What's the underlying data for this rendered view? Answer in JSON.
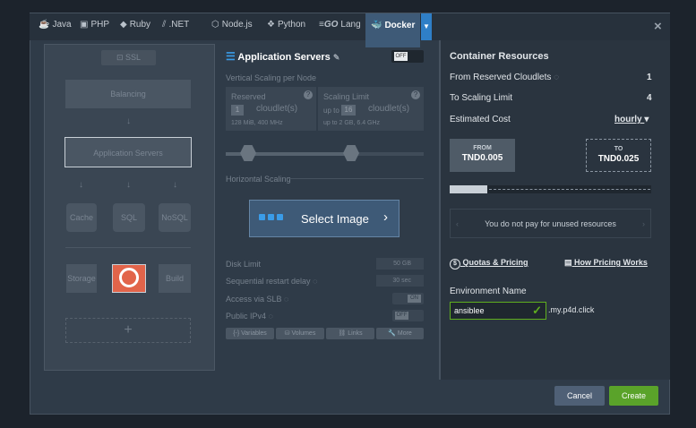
{
  "tabs": [
    {
      "label": "Java",
      "icon": "java-icon",
      "glyph": "☕"
    },
    {
      "label": "PHP",
      "icon": "php-icon",
      "glyph": "▣"
    },
    {
      "label": "Ruby",
      "icon": "ruby-icon",
      "glyph": "◆"
    },
    {
      "label": ".NET",
      "icon": "dotnet-icon",
      "glyph": "⫽"
    },
    {
      "label": "Node.js",
      "icon": "nodejs-icon",
      "glyph": "⬡"
    },
    {
      "label": "Python",
      "icon": "python-icon",
      "glyph": "❖"
    },
    {
      "label": "Lang",
      "icon": "go-icon",
      "glyph": "≡GO"
    },
    {
      "label": "Docker",
      "icon": "docker-icon",
      "glyph": "🐳"
    }
  ],
  "left": {
    "ssl": "SSL",
    "balancing": "Balancing",
    "app_servers": "Application Servers",
    "cache": "Cache",
    "sql": "SQL",
    "nosql": "NoSQL",
    "storage": "Storage",
    "build": "Build",
    "add": "+"
  },
  "mid": {
    "title": "Application Servers",
    "toggle": "OFF",
    "vertical": "Vertical Scaling per Node",
    "reserved": "Reserved",
    "reserved_value": "1",
    "reserved_unit": "cloudlet(s)",
    "reserved_info": "128 MiB, 400 MHz",
    "limit": "Scaling Limit",
    "limit_prefix": "up to",
    "limit_value": "16",
    "limit_unit": "cloudlet(s)",
    "limit_info": "up to 2 GB, 6.4 GHz",
    "horizontal": "Horizontal Scaling",
    "select_image": "Select Image",
    "disk_limit": "Disk Limit",
    "disk_value": "50 GB",
    "restart": "Sequential restart delay",
    "restart_value": "30 sec",
    "slb": "Access via SLB",
    "slb_value": "ON",
    "ipv4": "Public IPv4",
    "ipv4_value": "OFF",
    "variables": "Variables",
    "volumes": "Volumes",
    "links": "Links",
    "more": "More"
  },
  "right": {
    "title": "Container Resources",
    "from_reserved": "From Reserved Cloudlets",
    "from_reserved_value": "1",
    "to_limit": "To Scaling Limit",
    "to_limit_value": "4",
    "estimated": "Estimated Cost",
    "period": "hourly",
    "from_label": "FROM",
    "from_price": "TND0.005",
    "to_label": "TO",
    "to_price": "TND0.025",
    "unused": "You do not pay for unused resources",
    "quotas": "Quotas & Pricing",
    "pricing_works": "How Pricing Works",
    "env_name": "Environment Name",
    "env_value": "ansiblee",
    "domain": ".my.p4d.click"
  },
  "footer": {
    "cancel": "Cancel",
    "create": "Create"
  }
}
